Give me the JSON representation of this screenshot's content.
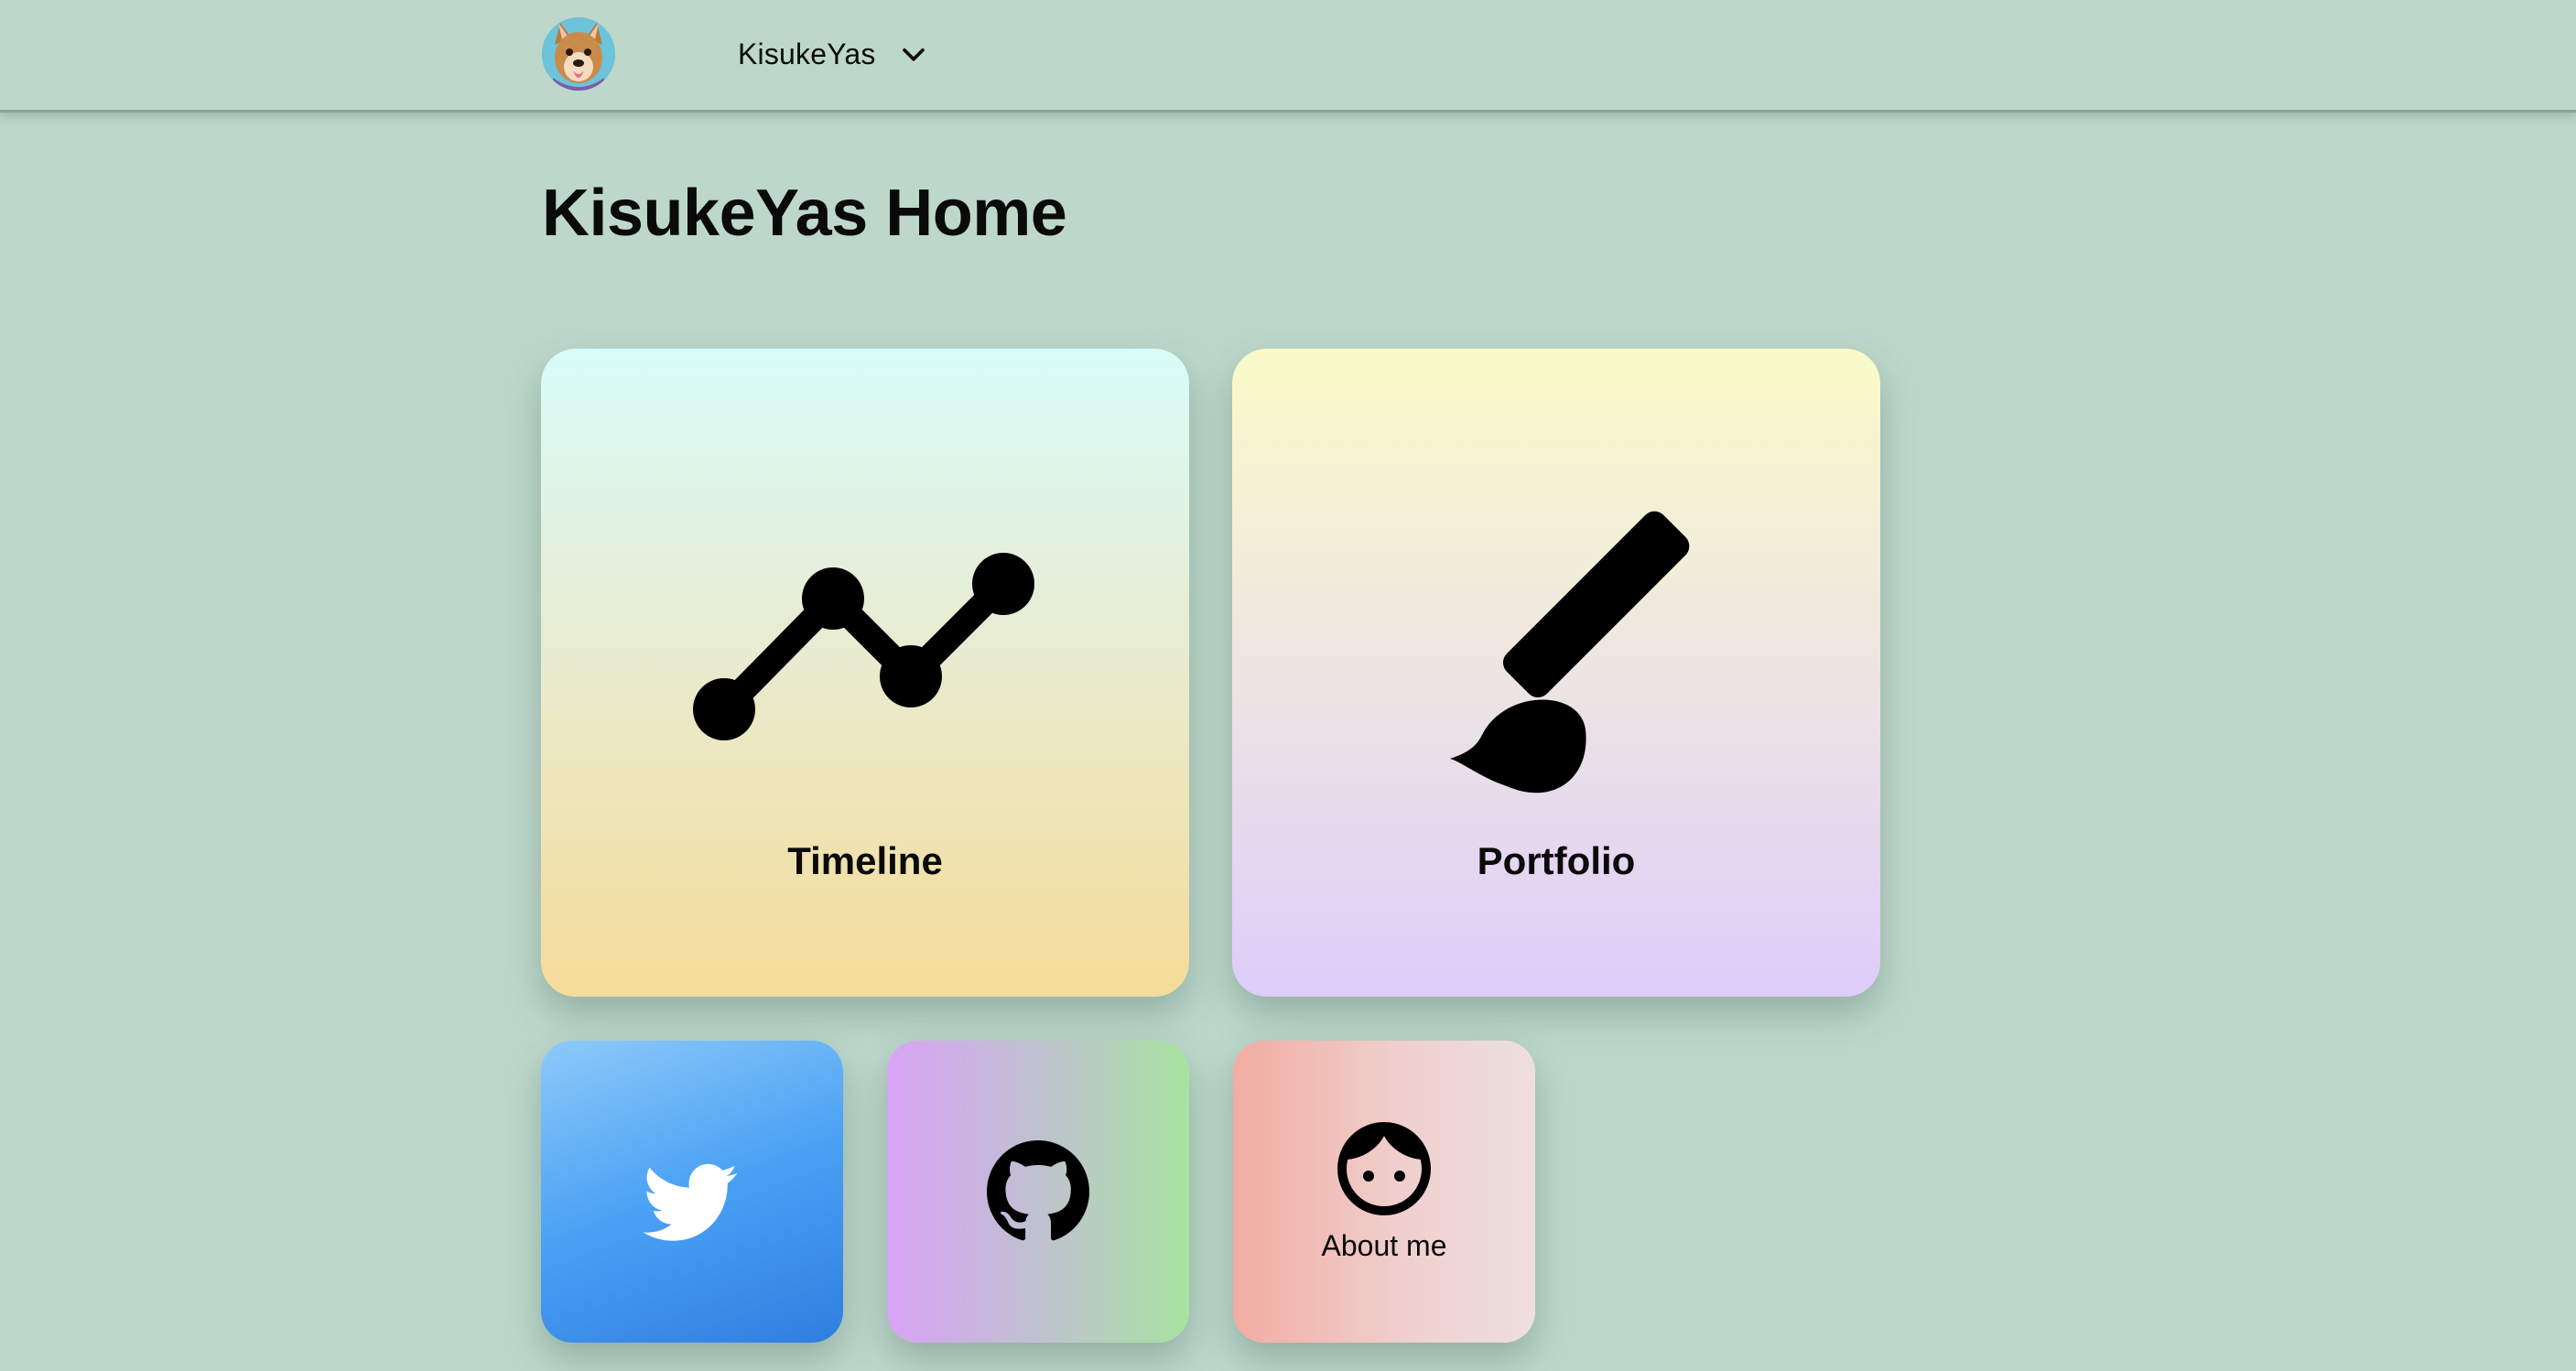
{
  "header": {
    "username": "KisukeYas",
    "avatar_icon": "dog-avatar",
    "dropdown_icon": "chevron-down-icon"
  },
  "page": {
    "title": "KisukeYas Home"
  },
  "cards": {
    "timeline": {
      "label": "Timeline",
      "icon": "line-chart-icon"
    },
    "portfolio": {
      "label": "Portfolio",
      "icon": "paintbrush-icon"
    },
    "twitter": {
      "icon": "twitter-bird-icon"
    },
    "github": {
      "icon": "github-octocat-icon"
    },
    "about": {
      "label": "About me",
      "icon": "face-icon"
    }
  },
  "colors": {
    "background": "#bdd8cb",
    "twitter_blue": "#4aa1f4"
  }
}
